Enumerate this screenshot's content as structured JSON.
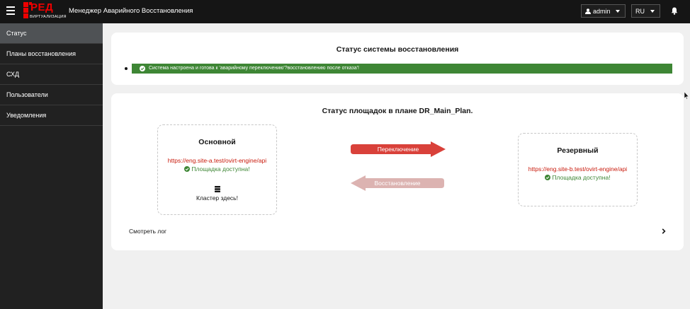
{
  "header": {
    "logo": {
      "brand_text": "РЕД",
      "sub_text": "ВИРТУАЛИЗАЦИЯ"
    },
    "app_title": "Менеджер Аварийного Восстановления",
    "user": "admin",
    "language": "RU"
  },
  "sidebar": {
    "items": [
      {
        "label": "Статус",
        "active": true
      },
      {
        "label": "Планы восстановления",
        "active": false
      },
      {
        "label": "СХД",
        "active": false
      },
      {
        "label": "Пользователи",
        "active": false
      },
      {
        "label": "Уведомления",
        "active": false
      }
    ]
  },
  "system_status": {
    "title": "Статус системы восстановления",
    "alert": "Система настроена и готова к 'аварийному переключению'?восстановлению после отказа'!"
  },
  "plan_status": {
    "title": "Статус площадок в плане DR_Main_Plan.",
    "primary": {
      "name": "Основной",
      "url": "https://eng.site-a.test/ovirt-engine/api",
      "status": "Площадка доступна!",
      "cluster": "Кластер здесь!"
    },
    "reserve": {
      "name": "Резервный",
      "url": "https://eng.site-b.test/ovirt-engine/api",
      "status": "Площадка доступна!"
    },
    "failover_label": "Переключение",
    "failback_label": "Восстановление",
    "log_link": "Смотреть лог"
  },
  "colors": {
    "success": "#3e8635",
    "danger": "#c9190b",
    "failover_arrow": "#d9413a",
    "failback_arrow": "#dcb3b1",
    "topbar": "#151515",
    "sidebar": "#212121",
    "sidebar_active": "#4f5255"
  }
}
